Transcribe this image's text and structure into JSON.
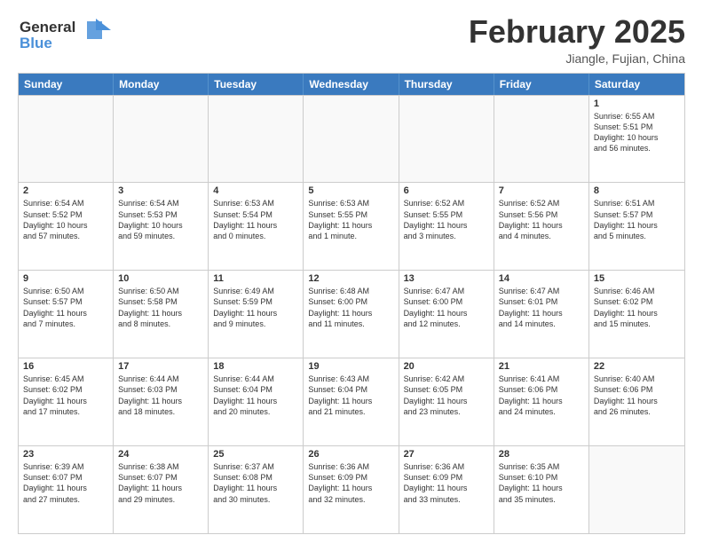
{
  "header": {
    "logo_line1": "General",
    "logo_line2": "Blue",
    "month": "February 2025",
    "location": "Jiangle, Fujian, China"
  },
  "weekdays": [
    "Sunday",
    "Monday",
    "Tuesday",
    "Wednesday",
    "Thursday",
    "Friday",
    "Saturday"
  ],
  "weeks": [
    [
      {
        "day": "",
        "text": ""
      },
      {
        "day": "",
        "text": ""
      },
      {
        "day": "",
        "text": ""
      },
      {
        "day": "",
        "text": ""
      },
      {
        "day": "",
        "text": ""
      },
      {
        "day": "",
        "text": ""
      },
      {
        "day": "1",
        "text": "Sunrise: 6:55 AM\nSunset: 5:51 PM\nDaylight: 10 hours\nand 56 minutes."
      }
    ],
    [
      {
        "day": "2",
        "text": "Sunrise: 6:54 AM\nSunset: 5:52 PM\nDaylight: 10 hours\nand 57 minutes."
      },
      {
        "day": "3",
        "text": "Sunrise: 6:54 AM\nSunset: 5:53 PM\nDaylight: 10 hours\nand 59 minutes."
      },
      {
        "day": "4",
        "text": "Sunrise: 6:53 AM\nSunset: 5:54 PM\nDaylight: 11 hours\nand 0 minutes."
      },
      {
        "day": "5",
        "text": "Sunrise: 6:53 AM\nSunset: 5:55 PM\nDaylight: 11 hours\nand 1 minute."
      },
      {
        "day": "6",
        "text": "Sunrise: 6:52 AM\nSunset: 5:55 PM\nDaylight: 11 hours\nand 3 minutes."
      },
      {
        "day": "7",
        "text": "Sunrise: 6:52 AM\nSunset: 5:56 PM\nDaylight: 11 hours\nand 4 minutes."
      },
      {
        "day": "8",
        "text": "Sunrise: 6:51 AM\nSunset: 5:57 PM\nDaylight: 11 hours\nand 5 minutes."
      }
    ],
    [
      {
        "day": "9",
        "text": "Sunrise: 6:50 AM\nSunset: 5:57 PM\nDaylight: 11 hours\nand 7 minutes."
      },
      {
        "day": "10",
        "text": "Sunrise: 6:50 AM\nSunset: 5:58 PM\nDaylight: 11 hours\nand 8 minutes."
      },
      {
        "day": "11",
        "text": "Sunrise: 6:49 AM\nSunset: 5:59 PM\nDaylight: 11 hours\nand 9 minutes."
      },
      {
        "day": "12",
        "text": "Sunrise: 6:48 AM\nSunset: 6:00 PM\nDaylight: 11 hours\nand 11 minutes."
      },
      {
        "day": "13",
        "text": "Sunrise: 6:47 AM\nSunset: 6:00 PM\nDaylight: 11 hours\nand 12 minutes."
      },
      {
        "day": "14",
        "text": "Sunrise: 6:47 AM\nSunset: 6:01 PM\nDaylight: 11 hours\nand 14 minutes."
      },
      {
        "day": "15",
        "text": "Sunrise: 6:46 AM\nSunset: 6:02 PM\nDaylight: 11 hours\nand 15 minutes."
      }
    ],
    [
      {
        "day": "16",
        "text": "Sunrise: 6:45 AM\nSunset: 6:02 PM\nDaylight: 11 hours\nand 17 minutes."
      },
      {
        "day": "17",
        "text": "Sunrise: 6:44 AM\nSunset: 6:03 PM\nDaylight: 11 hours\nand 18 minutes."
      },
      {
        "day": "18",
        "text": "Sunrise: 6:44 AM\nSunset: 6:04 PM\nDaylight: 11 hours\nand 20 minutes."
      },
      {
        "day": "19",
        "text": "Sunrise: 6:43 AM\nSunset: 6:04 PM\nDaylight: 11 hours\nand 21 minutes."
      },
      {
        "day": "20",
        "text": "Sunrise: 6:42 AM\nSunset: 6:05 PM\nDaylight: 11 hours\nand 23 minutes."
      },
      {
        "day": "21",
        "text": "Sunrise: 6:41 AM\nSunset: 6:06 PM\nDaylight: 11 hours\nand 24 minutes."
      },
      {
        "day": "22",
        "text": "Sunrise: 6:40 AM\nSunset: 6:06 PM\nDaylight: 11 hours\nand 26 minutes."
      }
    ],
    [
      {
        "day": "23",
        "text": "Sunrise: 6:39 AM\nSunset: 6:07 PM\nDaylight: 11 hours\nand 27 minutes."
      },
      {
        "day": "24",
        "text": "Sunrise: 6:38 AM\nSunset: 6:07 PM\nDaylight: 11 hours\nand 29 minutes."
      },
      {
        "day": "25",
        "text": "Sunrise: 6:37 AM\nSunset: 6:08 PM\nDaylight: 11 hours\nand 30 minutes."
      },
      {
        "day": "26",
        "text": "Sunrise: 6:36 AM\nSunset: 6:09 PM\nDaylight: 11 hours\nand 32 minutes."
      },
      {
        "day": "27",
        "text": "Sunrise: 6:36 AM\nSunset: 6:09 PM\nDaylight: 11 hours\nand 33 minutes."
      },
      {
        "day": "28",
        "text": "Sunrise: 6:35 AM\nSunset: 6:10 PM\nDaylight: 11 hours\nand 35 minutes."
      },
      {
        "day": "",
        "text": ""
      }
    ]
  ]
}
